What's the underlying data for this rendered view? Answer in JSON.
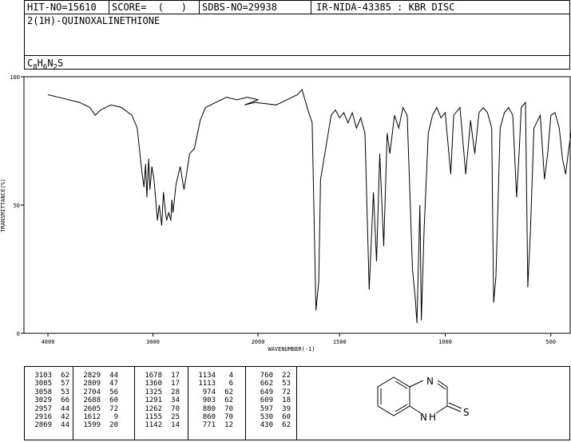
{
  "header": {
    "hit_no": "HIT-NO=15610",
    "score": "SCORE=  (   )",
    "sdbs_no": "SDBS-NO=29938",
    "ir_nida": "IR-NIDA-43385 : KBR DISC",
    "compound_name": "2(1H)-QUINOXALINETHIONE",
    "formula": {
      "c": "C",
      "c_sub": "8",
      "h": "H",
      "h_sub": "6",
      "n": "N",
      "n_sub": "2",
      "s": "S"
    }
  },
  "chart_data": {
    "type": "line",
    "title": "",
    "xlabel": "WAVENUMBER(-1)",
    "ylabel": "TRANSMITTANCE(%)",
    "xlim": [
      4000,
      400
    ],
    "ylim": [
      0,
      100
    ],
    "x_ticks": [
      "4000",
      "3000",
      "2000",
      "1500",
      "1000",
      "500"
    ],
    "y_ticks": [
      "100",
      "50",
      "0"
    ],
    "series": [
      {
        "points": [
          [
            4000,
            93
          ],
          [
            3900,
            92
          ],
          [
            3800,
            91
          ],
          [
            3700,
            90
          ],
          [
            3600,
            88
          ],
          [
            3550,
            85
          ],
          [
            3500,
            87
          ],
          [
            3400,
            89
          ],
          [
            3300,
            88
          ],
          [
            3200,
            85
          ],
          [
            3150,
            80
          ],
          [
            3103,
            62
          ],
          [
            3085,
            57
          ],
          [
            3070,
            66
          ],
          [
            3058,
            53
          ],
          [
            3040,
            68
          ],
          [
            3029,
            56
          ],
          [
            3010,
            65
          ],
          [
            2990,
            60
          ],
          [
            2957,
            44
          ],
          [
            2940,
            50
          ],
          [
            2916,
            42
          ],
          [
            2900,
            55
          ],
          [
            2880,
            47
          ],
          [
            2869,
            44
          ],
          [
            2850,
            47
          ],
          [
            2829,
            44
          ],
          [
            2820,
            52
          ],
          [
            2809,
            47
          ],
          [
            2780,
            58
          ],
          [
            2740,
            65
          ],
          [
            2704,
            56
          ],
          [
            2688,
            60
          ],
          [
            2650,
            70
          ],
          [
            2605,
            72
          ],
          [
            2550,
            83
          ],
          [
            2500,
            88
          ],
          [
            2400,
            90
          ],
          [
            2300,
            92
          ],
          [
            2200,
            91
          ],
          [
            2100,
            92
          ],
          [
            2000,
            91
          ],
          [
            1950,
            89
          ],
          [
            1900,
            90
          ],
          [
            1800,
            89
          ],
          [
            1750,
            91
          ],
          [
            1700,
            93
          ],
          [
            1678,
            95
          ],
          [
            1650,
            87
          ],
          [
            1630,
            82
          ],
          [
            1612,
            9
          ],
          [
            1599,
            20
          ],
          [
            1590,
            60
          ],
          [
            1560,
            75
          ],
          [
            1540,
            85
          ],
          [
            1520,
            87
          ],
          [
            1500,
            84
          ],
          [
            1480,
            86
          ],
          [
            1460,
            82
          ],
          [
            1440,
            86
          ],
          [
            1420,
            80
          ],
          [
            1400,
            84
          ],
          [
            1380,
            78
          ],
          [
            1360,
            17
          ],
          [
            1340,
            55
          ],
          [
            1325,
            28
          ],
          [
            1310,
            70
          ],
          [
            1291,
            34
          ],
          [
            1275,
            78
          ],
          [
            1262,
            70
          ],
          [
            1240,
            85
          ],
          [
            1220,
            80
          ],
          [
            1200,
            88
          ],
          [
            1180,
            85
          ],
          [
            1155,
            25
          ],
          [
            1142,
            14
          ],
          [
            1134,
            4
          ],
          [
            1120,
            50
          ],
          [
            1113,
            5
          ],
          [
            1100,
            40
          ],
          [
            1080,
            78
          ],
          [
            1060,
            85
          ],
          [
            1040,
            88
          ],
          [
            1020,
            84
          ],
          [
            1000,
            86
          ],
          [
            974,
            62
          ],
          [
            960,
            85
          ],
          [
            930,
            88
          ],
          [
            903,
            62
          ],
          [
            880,
            83
          ],
          [
            860,
            70
          ],
          [
            840,
            86
          ],
          [
            820,
            88
          ],
          [
            800,
            86
          ],
          [
            780,
            80
          ],
          [
            771,
            12
          ],
          [
            760,
            22
          ],
          [
            740,
            80
          ],
          [
            720,
            86
          ],
          [
            700,
            88
          ],
          [
            680,
            85
          ],
          [
            662,
            53
          ],
          [
            649,
            72
          ],
          [
            640,
            88
          ],
          [
            620,
            90
          ],
          [
            609,
            18
          ],
          [
            597,
            39
          ],
          [
            580,
            80
          ],
          [
            550,
            85
          ],
          [
            530,
            60
          ],
          [
            515,
            70
          ],
          [
            500,
            85
          ],
          [
            480,
            86
          ],
          [
            460,
            80
          ],
          [
            445,
            68
          ],
          [
            430,
            62
          ],
          [
            415,
            72
          ],
          [
            400,
            80
          ]
        ]
      }
    ]
  },
  "peak_table": {
    "columns": [
      [
        [
          "3103",
          "62"
        ],
        [
          "3085",
          "57"
        ],
        [
          "3058",
          "53"
        ],
        [
          "3029",
          "66"
        ],
        [
          "2957",
          "44"
        ],
        [
          "2916",
          "42"
        ],
        [
          "2869",
          "44"
        ]
      ],
      [
        [
          "2829",
          "44"
        ],
        [
          "2809",
          "47"
        ],
        [
          "2704",
          "56"
        ],
        [
          "2688",
          "60"
        ],
        [
          "2605",
          "72"
        ],
        [
          "1612",
          "9"
        ],
        [
          "1599",
          "20"
        ]
      ],
      [
        [
          "1678",
          "17"
        ],
        [
          "1360",
          "17"
        ],
        [
          "1325",
          "28"
        ],
        [
          "1291",
          "34"
        ],
        [
          "1262",
          "70"
        ],
        [
          "1155",
          "25"
        ],
        [
          "1142",
          "14"
        ]
      ],
      [
        [
          "1134",
          "4"
        ],
        [
          "1113",
          "6"
        ],
        [
          "974",
          "62"
        ],
        [
          "903",
          "62"
        ],
        [
          "880",
          "70"
        ],
        [
          "860",
          "70"
        ],
        [
          "771",
          "12"
        ]
      ],
      [
        [
          "760",
          "22"
        ],
        [
          "662",
          "53"
        ],
        [
          "649",
          "72"
        ],
        [
          "609",
          "18"
        ],
        [
          "597",
          "39"
        ],
        [
          "530",
          "60"
        ],
        [
          "430",
          "62"
        ]
      ]
    ]
  },
  "structure": {
    "atoms": [
      "N",
      "N",
      "H",
      "S"
    ]
  }
}
